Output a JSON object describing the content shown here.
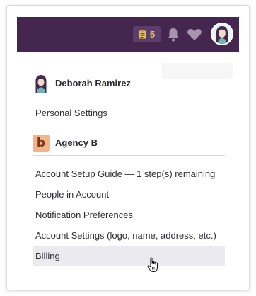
{
  "header": {
    "task_count": "5",
    "colors": {
      "bar": "#45264f",
      "pill": "#5c3e66",
      "badge": "#e8c25a",
      "icon": "#a795ad"
    }
  },
  "user": {
    "name": "Deborah Ramirez"
  },
  "personal": {
    "settings_label": "Personal Settings"
  },
  "agency": {
    "name": "Agency B",
    "logo_letter": "b",
    "logo_color": "#f2b488"
  },
  "menu": {
    "items": [
      {
        "label": "Account Setup Guide — 1 step(s) remaining"
      },
      {
        "label": "People in Account"
      },
      {
        "label": "Notification Preferences"
      },
      {
        "label": "Account Settings (logo, name, address, etc.)"
      },
      {
        "label": "Billing",
        "hovered": true
      }
    ]
  }
}
